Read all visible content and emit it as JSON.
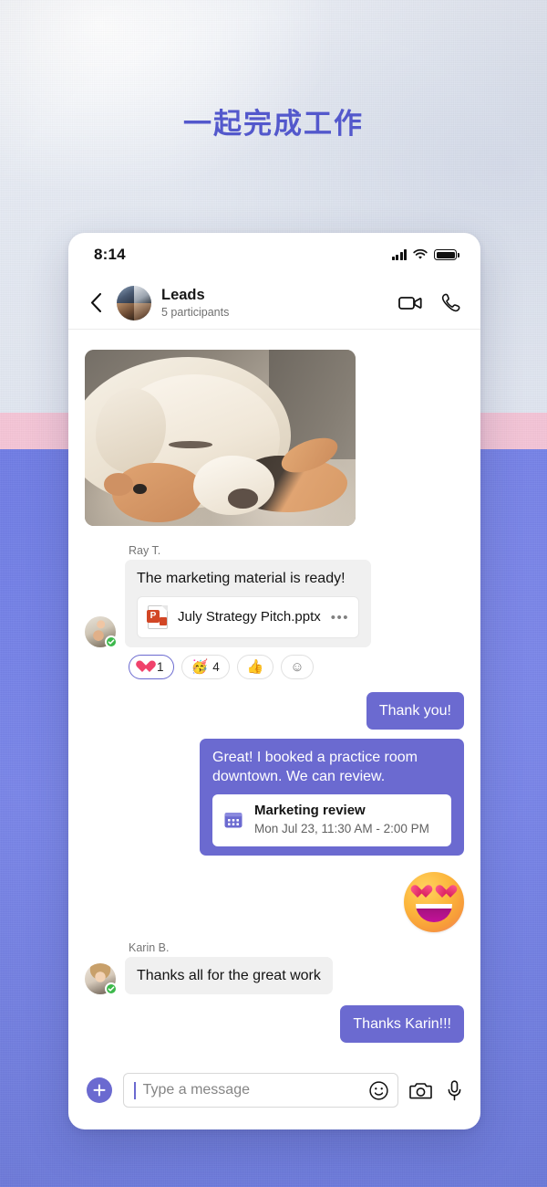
{
  "page": {
    "headline": "一起完成工作",
    "accent_purple": "#5358cc",
    "bubble_purple": "#6b6ad0",
    "band_pink": "#f4c4d6",
    "band_blue": "#7280e6"
  },
  "phone": {
    "status_bar": {
      "time": "8:14",
      "signal_icon": "cellular-signal-icon",
      "wifi_icon": "wifi-icon",
      "battery_icon": "battery-full-icon"
    },
    "chat_header": {
      "back_icon": "back-chevron-icon",
      "avatar_label": "group-avatar",
      "title": "Leads",
      "subtitle": "5 participants",
      "video_call_icon": "video-camera-icon",
      "audio_call_icon": "phone-handset-icon"
    },
    "messages": [
      {
        "id": "photo",
        "type": "image",
        "direction": "incoming",
        "alt": "sleeping cream labrador dog resting head on a plush toy"
      },
      {
        "id": "ray-message",
        "type": "text-with-file",
        "direction": "incoming",
        "author": "Ray T.",
        "presence": "available",
        "text": "The marketing material is ready!",
        "file": {
          "name": "July Strategy Pitch.pptx",
          "icon": "powerpoint-file-icon",
          "badge_letter": "P",
          "overflow": "•••"
        },
        "reactions": [
          {
            "emoji": "heart",
            "label": "❤",
            "count": "1",
            "selected": true
          },
          {
            "emoji": "party-face",
            "label": "🥳",
            "count": "4",
            "selected": false
          },
          {
            "emoji": "thumbs-up",
            "label": "👍",
            "count": "",
            "selected": false
          },
          {
            "emoji": "add-reaction",
            "label": "☺",
            "count": "",
            "selected": false
          }
        ]
      },
      {
        "id": "thank-you",
        "type": "text",
        "direction": "outgoing",
        "text": "Thank you!"
      },
      {
        "id": "practice-room",
        "type": "text-with-event",
        "direction": "outgoing",
        "text": "Great! I booked a practice room downtown. We can review.",
        "event": {
          "icon": "calendar-icon",
          "title": "Marketing review",
          "when": "Mon Jul 23, 11:30 AM - 2:00 PM"
        }
      },
      {
        "id": "sticker",
        "type": "sticker",
        "direction": "outgoing",
        "emoji": "heart-eyes-face"
      },
      {
        "id": "karin-message",
        "type": "text",
        "direction": "incoming",
        "author": "Karin B.",
        "presence": "available",
        "text": "Thanks all for the great work"
      },
      {
        "id": "thanks-karin",
        "type": "text",
        "direction": "outgoing",
        "text": "Thanks Karin!!!"
      }
    ],
    "composer": {
      "add_label": "+",
      "placeholder": "Type a message",
      "value": "",
      "emoji_icon": "emoji-smiley-icon",
      "camera_icon": "camera-icon",
      "mic_icon": "microphone-icon"
    }
  }
}
